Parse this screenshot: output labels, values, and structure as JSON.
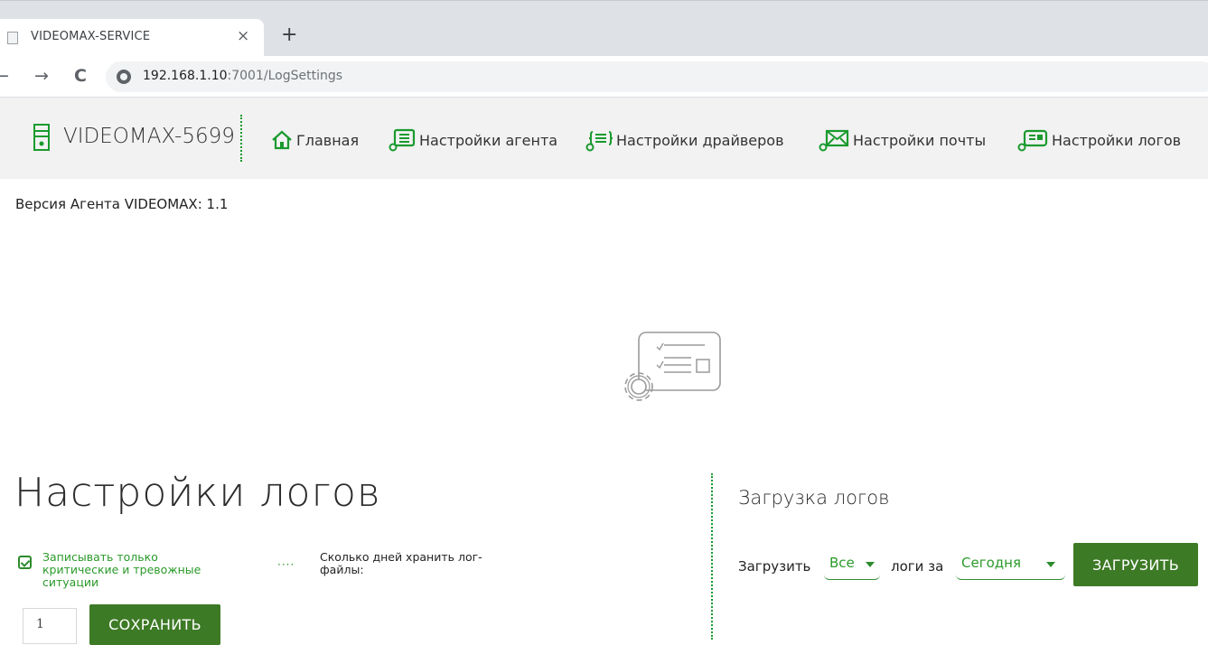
{
  "browser": {
    "tab_title": "VIDEOMAX-SERVICE",
    "tab_close": "×",
    "new_tab": "+",
    "back": "←",
    "forward": "→",
    "reload": "C",
    "url_host": "192.168.1.10",
    "url_path": ":7001/LogSettings"
  },
  "header": {
    "brand": "VIDEOMAX-5699",
    "nav": [
      {
        "label": "Главная",
        "icon": "home-icon"
      },
      {
        "label": "Настройки агента",
        "icon": "agent-settings-icon"
      },
      {
        "label": "Настройки драйверов",
        "icon": "driver-settings-icon"
      },
      {
        "label": "Настройки почты",
        "icon": "mail-settings-icon"
      },
      {
        "label": "Настройки логов",
        "icon": "log-settings-icon"
      }
    ],
    "accent_color": "#1a9a2e"
  },
  "version_text": "Версия Агента VIDEOMAX: 1.1",
  "log_settings": {
    "title": "Настройки логов",
    "critical_only_label": "Записывать только критические и тревожные ситуации",
    "critical_only_checked": true,
    "days_label": "Сколько дней хранить лог-файлы:",
    "days_value": "1",
    "save_label": "СОХРАНИТЬ"
  },
  "log_download": {
    "title": "Загрузка логов",
    "load_text": "Загрузить",
    "type_selected": "Все",
    "logs_for_text": "логи за",
    "period_selected": "Сегодня",
    "load_button": "ЗАГРУЗИТЬ"
  },
  "colors": {
    "button_bg": "#3d7a25",
    "green_text": "#2a9a2a"
  }
}
